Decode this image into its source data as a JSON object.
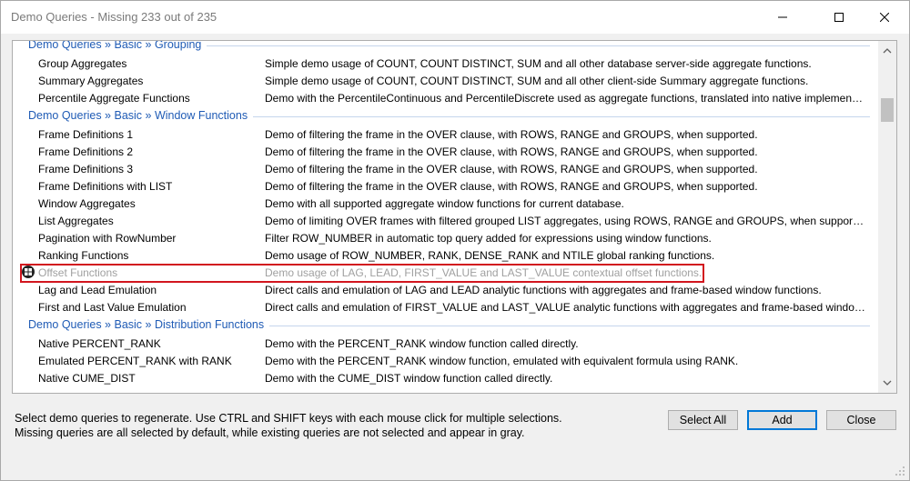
{
  "window": {
    "title": "Demo Queries - Missing 233 out of 235"
  },
  "groups": [
    {
      "header": "Demo Queries » Basic » Grouping",
      "items": [
        {
          "name": "Group Aggregates",
          "desc": "Simple demo usage of COUNT, COUNT DISTINCT, SUM and all other database server-side aggregate functions."
        },
        {
          "name": "Summary Aggregates",
          "desc": "Simple demo usage of COUNT, COUNT DISTINCT, SUM and all other client-side Summary aggregate functions."
        },
        {
          "name": "Percentile Aggregate Functions",
          "desc": "Demo with the PercentileContinuous and PercentileDiscrete used as aggregate functions, translated into native implementations ..."
        }
      ]
    },
    {
      "header": "Demo Queries » Basic » Window Functions",
      "items": [
        {
          "name": "Frame Definitions 1",
          "desc": "Demo of filtering the frame in the OVER clause, with ROWS, RANGE and GROUPS, when supported."
        },
        {
          "name": "Frame Definitions 2",
          "desc": "Demo of filtering the frame in the OVER clause, with ROWS, RANGE and GROUPS, when supported."
        },
        {
          "name": "Frame Definitions 3",
          "desc": "Demo of filtering the frame in the OVER clause, with ROWS, RANGE and GROUPS, when supported."
        },
        {
          "name": "Frame Definitions with LIST",
          "desc": "Demo of filtering the frame in the OVER clause, with ROWS, RANGE and GROUPS, when supported."
        },
        {
          "name": "Window Aggregates",
          "desc": "Demo with all supported aggregate window functions for current database."
        },
        {
          "name": "List Aggregates",
          "desc": "Demo of limiting OVER frames with filtered grouped LIST aggregates, using ROWS, RANGE and GROUPS, when supported."
        },
        {
          "name": "Pagination with RowNumber",
          "desc": "Filter ROW_NUMBER in automatic top query added for expressions using window functions."
        },
        {
          "name": "Ranking Functions",
          "desc": "Demo usage of ROW_NUMBER, RANK, DENSE_RANK and NTILE global ranking functions."
        },
        {
          "name": "Offset Functions",
          "desc": "Demo usage of LAG, LEAD, FIRST_VALUE and LAST_VALUE contextual offset functions.",
          "existing": true,
          "icon": "windows-icon"
        },
        {
          "name": "Lag and Lead Emulation",
          "desc": "Direct calls and emulation of LAG and LEAD analytic functions with aggregates and frame-based window functions."
        },
        {
          "name": "First and Last Value Emulation",
          "desc": "Direct calls and emulation of FIRST_VALUE and LAST_VALUE analytic functions with aggregates and frame-based window func..."
        }
      ]
    },
    {
      "header": "Demo Queries » Basic » Distribution Functions",
      "items": [
        {
          "name": "Native PERCENT_RANK",
          "desc": "Demo with the PERCENT_RANK window function called directly."
        },
        {
          "name": "Emulated PERCENT_RANK with RANK",
          "desc": "Demo with the PERCENT_RANK window function, emulated with equivalent formula using RANK."
        },
        {
          "name": "Native CUME_DIST",
          "desc": "Demo with the CUME_DIST window function called directly."
        }
      ]
    }
  ],
  "footer": {
    "line1": "Select demo queries to regenerate. Use CTRL and SHIFT keys with each mouse click for multiple selections.",
    "line2": "Missing queries are all selected by default, while existing queries are not selected and appear in gray."
  },
  "buttons": {
    "select_all": "Select All",
    "add": "Add",
    "close": "Close"
  },
  "colors": {
    "header_text": "#1f5bb5",
    "highlight_border": "#d2161e",
    "gray_text": "#a0a0a0"
  }
}
